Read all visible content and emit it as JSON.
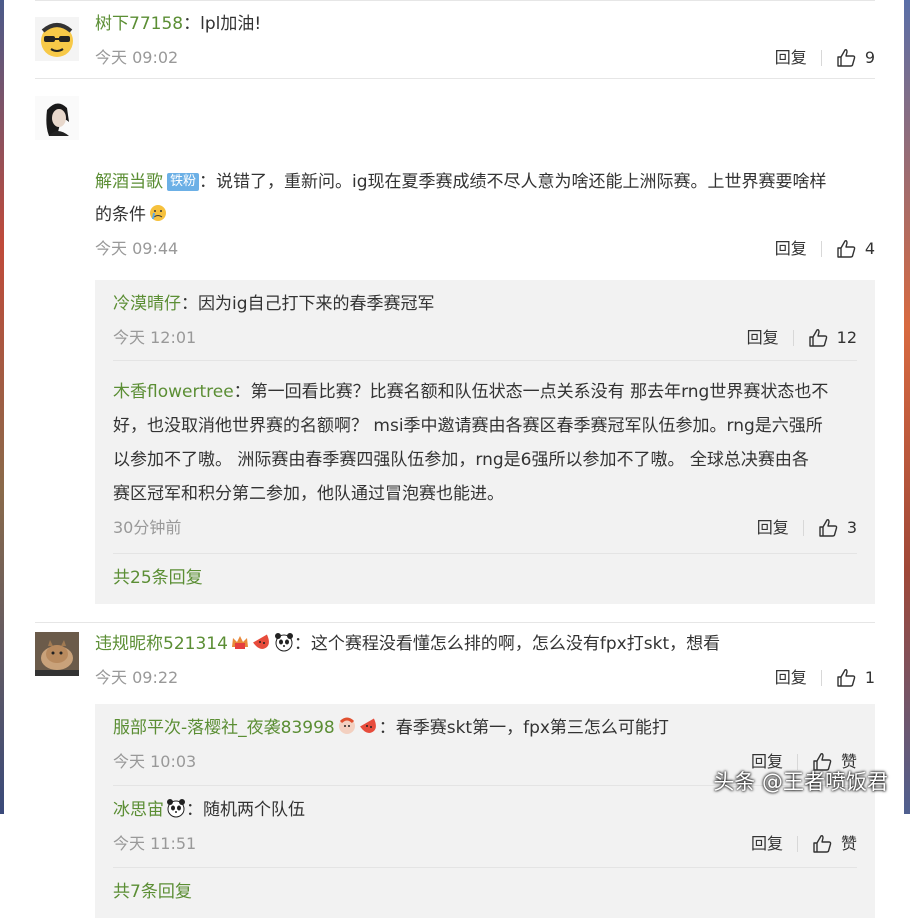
{
  "comments": [
    {
      "user": "树下77158",
      "text": "lpl加油!",
      "time": "今天 09:02",
      "reply_label": "回复",
      "likes": "9"
    },
    {
      "user": "解酒当歌",
      "badge": "铁粉",
      "text_line1": "说错了，重新问。ig现在夏季赛成绩不尽人意为啥还能上洲际赛。上世界赛要啥样",
      "text_line2": "的条件",
      "time": "今天 09:44",
      "reply_label": "回复",
      "likes": "4",
      "replies": [
        {
          "user": "冷漠晴仔",
          "text": "因为ig自己打下来的春季赛冠军",
          "time": "今天 12:01",
          "reply_label": "回复",
          "likes": "12"
        },
        {
          "user": "木香flowertree",
          "text_line1": "第一回看比赛？比赛名额和队伍状态一点关系没有 那去年rng世界赛状态也不",
          "text_line2": "好，也没取消他世界赛的名额啊？ msi季中邀请赛由各赛区春季赛冠军队伍参加。rng是六强所",
          "text_line3": "以参加不了嗷。 洲际赛由春季赛四强队伍参加，rng是6强所以参加不了嗷。 全球总决赛由各",
          "text_line4": "赛区冠军和积分第二参加，他队通过冒泡赛也能进。",
          "time": "30分钟前",
          "reply_label": "回复",
          "likes": "3"
        }
      ],
      "more": "共25条回复"
    },
    {
      "user": "违规昵称521314",
      "text": "这个赛程没看懂怎么排的啊，怎么没有fpx打skt，想看",
      "time": "今天 09:22",
      "reply_label": "回复",
      "likes": "1",
      "replies": [
        {
          "user": "服部平次-落樱社_夜袭83998",
          "text": "春季赛skt第一，fpx第三怎么可能打",
          "time": "今天 10:03",
          "reply_label": "回复",
          "likes": "赞"
        },
        {
          "user": "冰思宙",
          "text": "随机两个队伍",
          "time": "今天 11:51",
          "reply_label": "回复",
          "likes": "赞"
        }
      ],
      "more": "共7条回复"
    }
  ],
  "colon": "：",
  "watermark": "头条 @王者喷饭君"
}
